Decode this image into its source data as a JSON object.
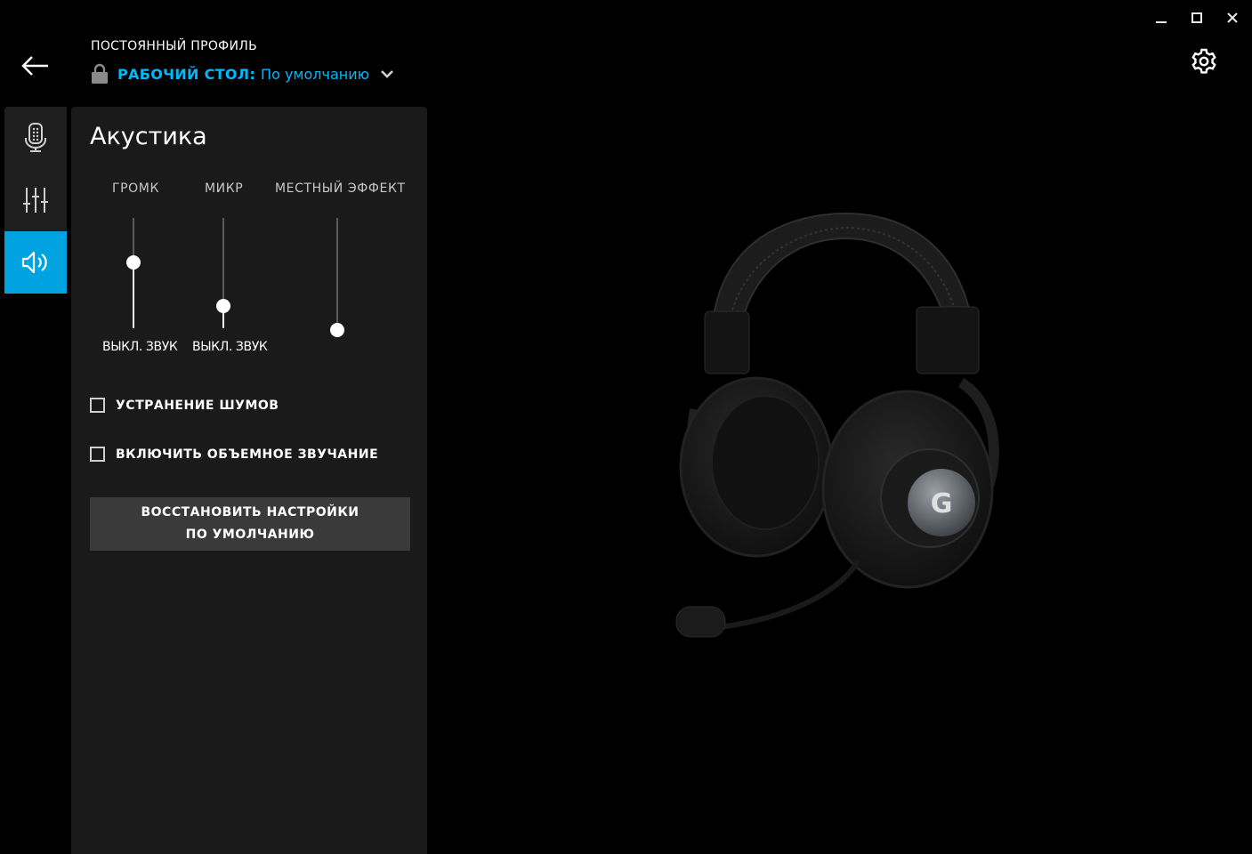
{
  "window": {
    "minimize_icon": "minimize-icon",
    "maximize_icon": "maximize-icon",
    "close_icon": "close-icon"
  },
  "header": {
    "back_icon": "arrow-left-icon",
    "profile_caption": "ПОСТОЯННЫЙ ПРОФИЛЬ",
    "profile_key": "РАБОЧИЙ СТОЛ:",
    "profile_value": "По умолчанию",
    "lock_icon": "lock-icon",
    "dropdown_icon": "chevron-down-icon",
    "settings_icon": "gear-icon"
  },
  "sidenav": {
    "items": [
      {
        "name": "microphone",
        "icon": "microphone-icon",
        "active": false
      },
      {
        "name": "equalizer",
        "icon": "equalizer-icon",
        "active": false
      },
      {
        "name": "acoustics",
        "icon": "speaker-icon",
        "active": true
      }
    ]
  },
  "panel": {
    "title": "Акустика",
    "sliders": [
      {
        "label": "ГРОМК",
        "level": 0.6,
        "mute_label": "ВЫКЛ. ЗВУК"
      },
      {
        "label": "МИКР",
        "level": 0.2,
        "mute_label": "ВЫКЛ. ЗВУК"
      },
      {
        "label": "МЕСТНЫЙ ЭФФЕКТ",
        "level": 0.0
      }
    ],
    "checkboxes": [
      {
        "label": "УСТРАНЕНИЕ ШУМОВ",
        "checked": false
      },
      {
        "label": "ВКЛЮЧИТЬ ОБЪЕМНОЕ ЗВУЧАНИЕ",
        "checked": false
      }
    ],
    "reset_button": "ВОССТАНОВИТЬ НАСТРОЙКИ ПО УМОЛЧАНИЮ"
  },
  "colors": {
    "accent": "#00b8fc",
    "active_nav": "#00a3e0",
    "panel_bg": "#1a1a1a",
    "background": "#000000"
  },
  "product_image": "headset-image"
}
